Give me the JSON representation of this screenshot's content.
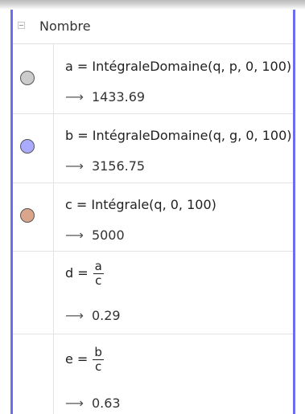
{
  "header": {
    "label": "Nombre"
  },
  "rows": [
    {
      "definition": "a = IntégraleDomaine(q, p, 0, 100)",
      "result": "1433.69",
      "dot_color": "#cccccc"
    },
    {
      "definition": "b = IntégraleDomaine(q, g, 0, 100)",
      "result": "3156.75",
      "dot_color": "#aaaaff"
    },
    {
      "definition": "c = Intégrale(q, 0, 100)",
      "result": "5000",
      "dot_color": "#d9a68c"
    },
    {
      "lhs": "d =",
      "num": "a",
      "den": "c",
      "result": "0.29"
    },
    {
      "lhs": "e =",
      "num": "b",
      "den": "c",
      "result": "0.63"
    }
  ],
  "arrow": "⟶"
}
